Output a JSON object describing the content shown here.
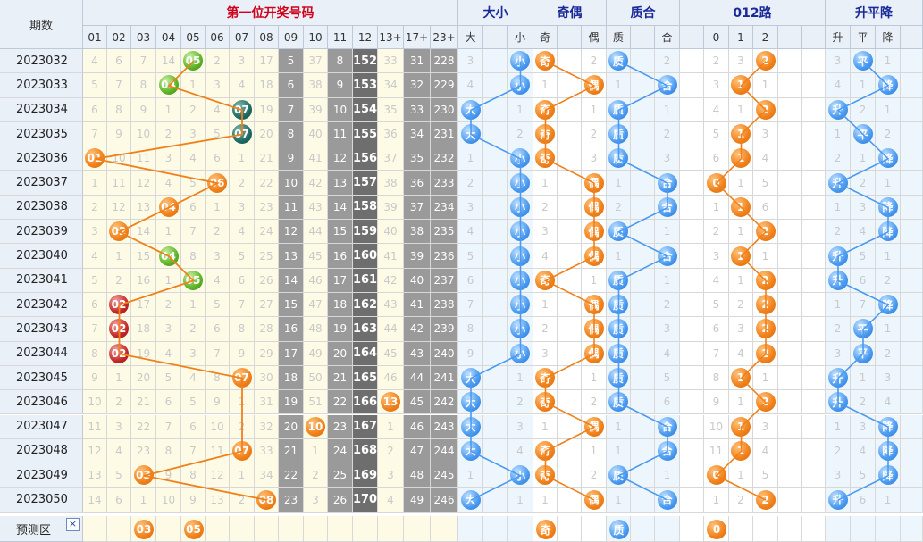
{
  "header": {
    "period": "期数",
    "main": "第一位开奖号码",
    "dx": "大小",
    "jo": "奇偶",
    "zh": "质合",
    "road": "012路",
    "spj": "升平降"
  },
  "col_headers": {
    "num": [
      "01",
      "02",
      "03",
      "04",
      "05",
      "06",
      "07",
      "08",
      "09",
      "10",
      "11",
      "12",
      "13+",
      "17+",
      "23+"
    ],
    "dx": [
      "大",
      "",
      "小"
    ],
    "jo": [
      "奇",
      "",
      "偶"
    ],
    "zh": [
      "质",
      "",
      "合"
    ],
    "road": [
      "0",
      "1",
      "2"
    ],
    "spj": [
      "升",
      "平",
      "降"
    ]
  },
  "colors": {
    "orange": "#f0801a",
    "blue": "#4a9af0",
    "green": "#5cb428",
    "red": "#c42828",
    "teal": "#1e6a64",
    "grp_main": "#d0021b",
    "grp_other": "#1a2a99"
  },
  "predict": {
    "label": "预测区",
    "close_icon": "×",
    "balls": [
      "03",
      "05",
      "奇",
      "质",
      "0"
    ]
  },
  "rows": [
    {
      "p": "2023032",
      "n": [
        "4",
        "6",
        "7",
        "14",
        "05",
        "2",
        "3",
        "17",
        "5",
        "37",
        "8",
        "152",
        "33",
        "31",
        "228"
      ],
      "dx": [
        "3",
        "",
        "小"
      ],
      "jo": [
        "奇",
        "",
        "2"
      ],
      "zh": [
        "质",
        "",
        "2"
      ],
      "r": [
        "2",
        "3",
        "2"
      ],
      "s": [
        "3",
        "平",
        "1"
      ],
      "bc": "green"
    },
    {
      "p": "2023033",
      "n": [
        "5",
        "7",
        "8",
        "04",
        "1",
        "3",
        "4",
        "18",
        "6",
        "38",
        "9",
        "153",
        "34",
        "32",
        "229"
      ],
      "dx": [
        "4",
        "",
        "小"
      ],
      "jo": [
        "1",
        "",
        "偶"
      ],
      "zh": [
        "1",
        "",
        "合"
      ],
      "r": [
        "3",
        "1",
        "1"
      ],
      "s": [
        "4",
        "1",
        "降"
      ],
      "bc": "green"
    },
    {
      "p": "2023034",
      "n": [
        "6",
        "8",
        "9",
        "1",
        "2",
        "4",
        "07",
        "19",
        "7",
        "39",
        "10",
        "154",
        "35",
        "33",
        "230"
      ],
      "dx": [
        "大",
        "",
        "1"
      ],
      "jo": [
        "奇",
        "",
        "1"
      ],
      "zh": [
        "质",
        "",
        "1"
      ],
      "r": [
        "4",
        "1",
        "2"
      ],
      "s": [
        "升",
        "2",
        "1"
      ],
      "bc": "teal"
    },
    {
      "p": "2023035",
      "n": [
        "7",
        "9",
        "10",
        "2",
        "3",
        "5",
        "07",
        "20",
        "8",
        "40",
        "11",
        "155",
        "36",
        "34",
        "231"
      ],
      "dx": [
        "大",
        "",
        "2"
      ],
      "jo": [
        "奇",
        "",
        "2"
      ],
      "zh": [
        "质",
        "",
        "2"
      ],
      "r": [
        "5",
        "1",
        "3"
      ],
      "s": [
        "1",
        "平",
        "2"
      ],
      "bc": "teal"
    },
    {
      "p": "2023036",
      "n": [
        "01",
        "10",
        "11",
        "3",
        "4",
        "6",
        "1",
        "21",
        "9",
        "41",
        "12",
        "156",
        "37",
        "35",
        "232"
      ],
      "dx": [
        "1",
        "",
        "小"
      ],
      "jo": [
        "奇",
        "",
        "3"
      ],
      "zh": [
        "质",
        "",
        "3"
      ],
      "r": [
        "6",
        "1",
        "4"
      ],
      "s": [
        "2",
        "1",
        "降"
      ],
      "bc": "orange"
    },
    {
      "p": "2023037",
      "n": [
        "1",
        "11",
        "12",
        "4",
        "5",
        "06",
        "2",
        "22",
        "10",
        "42",
        "13",
        "157",
        "38",
        "36",
        "233"
      ],
      "dx": [
        "2",
        "",
        "小"
      ],
      "jo": [
        "1",
        "",
        "偶"
      ],
      "zh": [
        "1",
        "",
        "合"
      ],
      "r": [
        "0",
        "1",
        "5"
      ],
      "s": [
        "升",
        "2",
        "1"
      ],
      "bc": "orange"
    },
    {
      "p": "2023038",
      "n": [
        "2",
        "12",
        "13",
        "04",
        "6",
        "1",
        "3",
        "23",
        "11",
        "43",
        "14",
        "158",
        "39",
        "37",
        "234"
      ],
      "dx": [
        "3",
        "",
        "小"
      ],
      "jo": [
        "2",
        "",
        "偶"
      ],
      "zh": [
        "2",
        "",
        "合"
      ],
      "r": [
        "1",
        "1",
        "6"
      ],
      "s": [
        "1",
        "3",
        "降"
      ],
      "bc": "orange"
    },
    {
      "p": "2023039",
      "n": [
        "3",
        "02",
        "14",
        "1",
        "7",
        "2",
        "4",
        "24",
        "12",
        "44",
        "15",
        "159",
        "40",
        "38",
        "235"
      ],
      "dx": [
        "4",
        "",
        "小"
      ],
      "jo": [
        "3",
        "",
        "偶"
      ],
      "zh": [
        "质",
        "",
        "1"
      ],
      "r": [
        "2",
        "1",
        "2"
      ],
      "s": [
        "2",
        "4",
        "降"
      ],
      "bc": "orange"
    },
    {
      "p": "2023040",
      "n": [
        "4",
        "1",
        "15",
        "04",
        "8",
        "3",
        "5",
        "25",
        "13",
        "45",
        "16",
        "160",
        "41",
        "39",
        "236"
      ],
      "dx": [
        "5",
        "",
        "小"
      ],
      "jo": [
        "4",
        "",
        "偶"
      ],
      "zh": [
        "1",
        "",
        "合"
      ],
      "r": [
        "3",
        "1",
        "1"
      ],
      "s": [
        "升",
        "5",
        "1"
      ],
      "bc": "green"
    },
    {
      "p": "2023041",
      "n": [
        "5",
        "2",
        "16",
        "1",
        "05",
        "4",
        "6",
        "26",
        "14",
        "46",
        "17",
        "161",
        "42",
        "40",
        "237"
      ],
      "dx": [
        "6",
        "",
        "小"
      ],
      "jo": [
        "奇",
        "",
        "1"
      ],
      "zh": [
        "质",
        "",
        "1"
      ],
      "r": [
        "4",
        "1",
        "2"
      ],
      "s": [
        "升",
        "6",
        "2"
      ],
      "bc": "green"
    },
    {
      "p": "2023042",
      "n": [
        "6",
        "02",
        "17",
        "2",
        "1",
        "5",
        "7",
        "27",
        "15",
        "47",
        "18",
        "162",
        "43",
        "41",
        "238"
      ],
      "dx": [
        "7",
        "",
        "小"
      ],
      "jo": [
        "1",
        "",
        "偶"
      ],
      "zh": [
        "质",
        "",
        "2"
      ],
      "r": [
        "5",
        "2",
        "2"
      ],
      "s": [
        "1",
        "7",
        "降"
      ],
      "bc": "red"
    },
    {
      "p": "2023043",
      "n": [
        "7",
        "02",
        "18",
        "3",
        "2",
        "6",
        "8",
        "28",
        "16",
        "48",
        "19",
        "163",
        "44",
        "42",
        "239"
      ],
      "dx": [
        "8",
        "",
        "小"
      ],
      "jo": [
        "2",
        "",
        "偶"
      ],
      "zh": [
        "质",
        "",
        "3"
      ],
      "r": [
        "6",
        "3",
        "2"
      ],
      "s": [
        "2",
        "平",
        "1"
      ],
      "bc": "red"
    },
    {
      "p": "2023044",
      "n": [
        "8",
        "02",
        "19",
        "4",
        "3",
        "7",
        "9",
        "29",
        "17",
        "49",
        "20",
        "164",
        "45",
        "43",
        "240"
      ],
      "dx": [
        "9",
        "",
        "小"
      ],
      "jo": [
        "3",
        "",
        "偶"
      ],
      "zh": [
        "质",
        "",
        "4"
      ],
      "r": [
        "7",
        "4",
        "2"
      ],
      "s": [
        "3",
        "平",
        "2"
      ],
      "bc": "red"
    },
    {
      "p": "2023045",
      "n": [
        "9",
        "1",
        "20",
        "5",
        "4",
        "8",
        "07",
        "30",
        "18",
        "50",
        "21",
        "165",
        "46",
        "44",
        "241"
      ],
      "dx": [
        "大",
        "",
        "1"
      ],
      "jo": [
        "奇",
        "",
        "1"
      ],
      "zh": [
        "质",
        "",
        "5"
      ],
      "r": [
        "8",
        "1",
        "1"
      ],
      "s": [
        "升",
        "1",
        "3"
      ],
      "bc": "orange"
    },
    {
      "p": "2023046",
      "n": [
        "10",
        "2",
        "21",
        "6",
        "5",
        "9",
        "1",
        "31",
        "19",
        "51",
        "22",
        "166",
        "13",
        "45",
        "242"
      ],
      "dx": [
        "大",
        "",
        "2"
      ],
      "jo": [
        "奇",
        "",
        "2"
      ],
      "zh": [
        "质",
        "",
        "6"
      ],
      "r": [
        "9",
        "1",
        "2"
      ],
      "s": [
        "升",
        "2",
        "4"
      ],
      "bc": "orange"
    },
    {
      "p": "2023047",
      "n": [
        "11",
        "3",
        "22",
        "7",
        "6",
        "10",
        "2",
        "32",
        "20",
        "10",
        "23",
        "167",
        "1",
        "46",
        "243"
      ],
      "dx": [
        "大",
        "",
        "3"
      ],
      "jo": [
        "1",
        "",
        "偶"
      ],
      "zh": [
        "1",
        "",
        "合"
      ],
      "r": [
        "10",
        "1",
        "3"
      ],
      "s": [
        "1",
        "3",
        "降"
      ],
      "bc": "orange"
    },
    {
      "p": "2023048",
      "n": [
        "12",
        "4",
        "23",
        "8",
        "7",
        "11",
        "07",
        "33",
        "21",
        "1",
        "24",
        "168",
        "2",
        "47",
        "244"
      ],
      "dx": [
        "大",
        "",
        "4"
      ],
      "jo": [
        "奇",
        "",
        "1"
      ],
      "zh": [
        "1",
        "",
        "合"
      ],
      "r": [
        "11",
        "1",
        "4"
      ],
      "s": [
        "2",
        "4",
        "降"
      ],
      "bc": "orange"
    },
    {
      "p": "2023049",
      "n": [
        "13",
        "5",
        "03",
        "9",
        "8",
        "12",
        "1",
        "34",
        "22",
        "2",
        "25",
        "169",
        "3",
        "48",
        "245"
      ],
      "dx": [
        "1",
        "",
        "小"
      ],
      "jo": [
        "奇",
        "",
        "2"
      ],
      "zh": [
        "质",
        "",
        "1"
      ],
      "r": [
        "0",
        "1",
        "5"
      ],
      "s": [
        "3",
        "5",
        "降"
      ],
      "bc": "orange"
    },
    {
      "p": "2023050",
      "n": [
        "14",
        "6",
        "1",
        "10",
        "9",
        "13",
        "2",
        "08",
        "23",
        "3",
        "26",
        "170",
        "4",
        "49",
        "246"
      ],
      "dx": [
        "大",
        "",
        "1"
      ],
      "jo": [
        "1",
        "",
        "偶"
      ],
      "zh": [
        "1",
        "",
        "合"
      ],
      "r": [
        "1",
        "2",
        "2"
      ],
      "s": [
        "升",
        "6",
        "1"
      ],
      "bc": "orange"
    }
  ]
}
